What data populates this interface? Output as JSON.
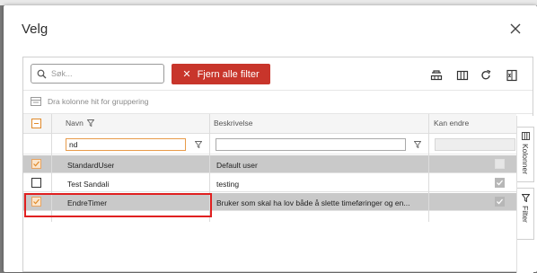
{
  "modal": {
    "title": "Velg"
  },
  "toolbar": {
    "search_placeholder": "Søk...",
    "clear_filters_label": "Fjern alle filter",
    "group_hint": "Dra kolonne hit for gruppering"
  },
  "columns": {
    "name": "Navn",
    "description": "Beskrivelse",
    "can_edit": "Kan endre"
  },
  "filters": {
    "name_value": "nd",
    "description_value": ""
  },
  "rows": [
    {
      "name": "StandardUser",
      "description": "Default user",
      "selected": true,
      "can_edit": false
    },
    {
      "name": "Test Sandali",
      "description": "testing",
      "selected": false,
      "can_edit": true
    },
    {
      "name": "EndreTimer",
      "description": "Bruker som skal ha lov både å slette timeføringer og en...",
      "selected": true,
      "can_edit": true
    }
  ],
  "side_tabs": {
    "columns": "Kolonner",
    "filter": "Filter"
  },
  "colors": {
    "accent_red": "#c8352b",
    "highlight_red": "#e02020",
    "checkbox_orange": "#e08a2b",
    "selected_row": "#c9c9c9"
  },
  "icons": [
    "search-icon",
    "close-icon",
    "grouping-icon",
    "columns-icon",
    "refresh-icon",
    "export-icon",
    "funnel-icon"
  ]
}
